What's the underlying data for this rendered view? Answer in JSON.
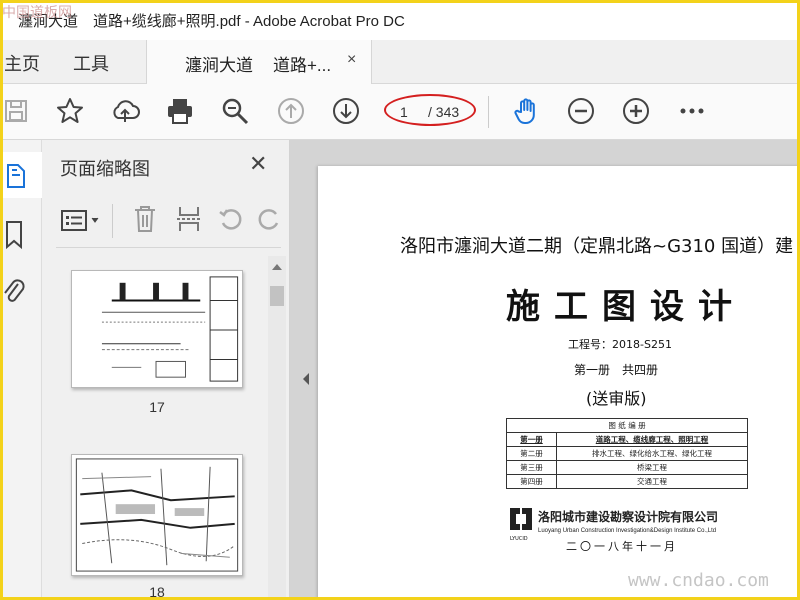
{
  "window": {
    "title": "瀍涧大道　道路+缆线廊+照明.pdf - Adobe Acrobat Pro DC",
    "corner_watermark": "中国道板网"
  },
  "menu": {
    "home_label": "主页",
    "tools_label": "工具"
  },
  "doc_tab": {
    "part1": "瀍涧大道",
    "part2": "道路+...",
    "close": "×"
  },
  "toolbar": {
    "current_page": "1",
    "total_pages": "/ 343",
    "icons": [
      "save-icon",
      "star-icon",
      "upload-icon",
      "print-icon",
      "zoom-search-icon",
      "page-up-icon",
      "page-down-icon",
      "hand-icon",
      "zoom-out-icon",
      "zoom-in-icon",
      "more-icon"
    ]
  },
  "panel": {
    "title": "页面缩略图",
    "close": "✕",
    "thumbnails": [
      {
        "label": "17"
      },
      {
        "label": "18"
      }
    ]
  },
  "page": {
    "title_line": "洛阳市瀍涧大道二期（定鼎北路~G310 国道）建",
    "big_title": "施工图设计",
    "project_no": "工程号：2018-S251",
    "volume": "第一册　共四册",
    "version": "(送审版)",
    "table": {
      "header": "图 纸 编 册",
      "rows": [
        {
          "vol": "第一册",
          "content": "道路工程、缆线廊工程、照明工程",
          "highlight": true
        },
        {
          "vol": "第二册",
          "content": "排水工程、绿化给水工程、绿化工程",
          "highlight": false
        },
        {
          "vol": "第三册",
          "content": "桥梁工程",
          "highlight": false
        },
        {
          "vol": "第四册",
          "content": "交通工程",
          "highlight": false
        }
      ]
    },
    "org_cn": "洛阳城市建设勘察设计院有限公司",
    "org_en": "Luoyang Urban Construction Investigation&Design Institute Co.,Ltd",
    "logo_text": "LYUCID",
    "date": "二〇一八年十一月"
  },
  "site_watermark": "www.cndao.com",
  "colors": {
    "highlight_ring": "#d41f1f",
    "hand_tool": "#1a73d9",
    "frame": "#f3d21a"
  }
}
